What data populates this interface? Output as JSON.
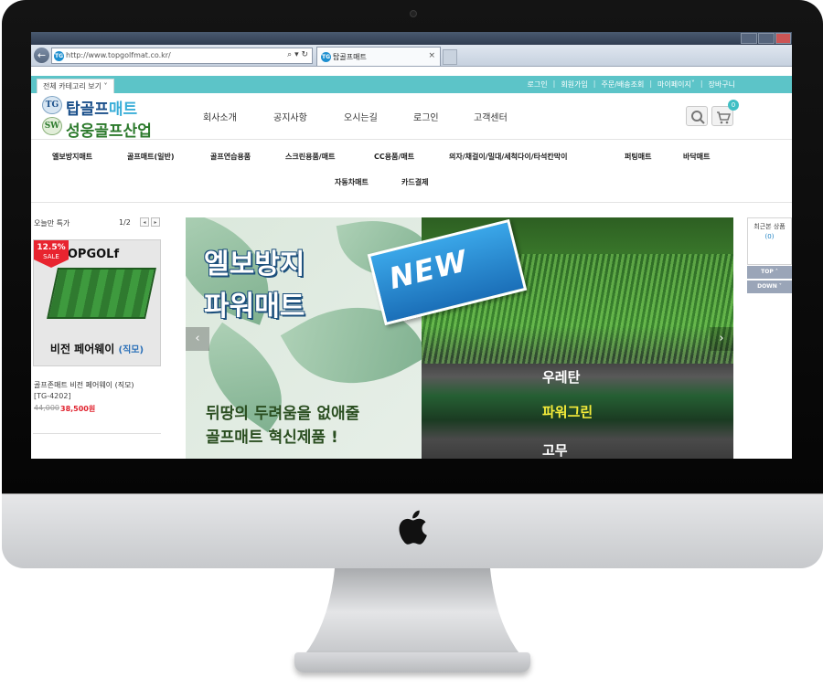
{
  "browser": {
    "url": "http://www.topgolfmat.co.kr/",
    "address_icons": "⌕ ▾ ↻",
    "back_icon": "←",
    "tab_title": "탑골프매트",
    "tab_close": "×",
    "favicon_text": "TG"
  },
  "site": {
    "category_button": "전체 카테고리 보기",
    "util_links": [
      "로그인",
      "회원가입",
      "주문/배송조회",
      "마이페이지",
      "장바구니"
    ],
    "logo": {
      "badge1": "TG",
      "line1_main": "탑골프",
      "line1_highlight": "매트",
      "badge2": "SW",
      "line2": "성웅골프산업"
    },
    "main_nav": [
      "회사소개",
      "공지사항",
      "오시는길",
      "로그인",
      "고객센터"
    ],
    "cart_count": "0",
    "category_nav_row1": [
      "엘보방지매트",
      "골프매트(일반)",
      "골프연습용품",
      "스크린용품/매트",
      "CC용품/매트",
      "의자/채걸이/밀대/세척다이/타석칸막이",
      "퍼팅매트",
      "바닥매트"
    ],
    "category_nav_row2": [
      "자동차매트",
      "카드결제"
    ]
  },
  "sidebar": {
    "deal_title": "오늘만 특가",
    "deal_page": "1/2",
    "prev_icon": "◂",
    "next_icon": "▸",
    "product": {
      "sale_pct": "12.5%",
      "sale_label": "SALE",
      "brand": "TOPGOLf",
      "caption": "비전 페어웨이",
      "caption_sub": "(직모)",
      "name": "골프존매트 비전 페어웨이 (직모)",
      "code": "[TG-4202]",
      "price_old": "44,000",
      "price_new": "38,500원"
    }
  },
  "banner": {
    "title1": "엘보방지",
    "title2": "파워매트",
    "new_label": "NEW",
    "sub1": "뒤땅의 두려움을 없애줄",
    "sub2": "골프매트 혁신제품 !",
    "layers": [
      "우레탄",
      "파워그린",
      "고무"
    ],
    "prev_arrow": "‹",
    "next_arrow": "›"
  },
  "right_panel": {
    "recent_label": "최근본 상품",
    "recent_count": "(0)",
    "top_label": "TOP ˄",
    "down_label": "DOWN ˅"
  },
  "colors": {
    "accent_teal": "#5cc4c8",
    "sale_red": "#e8242f",
    "price_red": "#e0222e",
    "link_blue": "#1a7fc2"
  }
}
